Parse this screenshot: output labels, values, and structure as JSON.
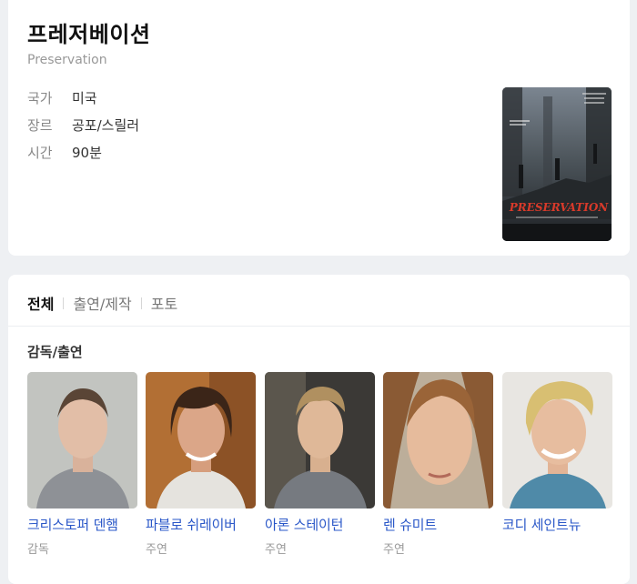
{
  "movie": {
    "title": "프레저베이션",
    "original_title": "Preservation",
    "info": [
      {
        "label": "국가",
        "value": "미국"
      },
      {
        "label": "장르",
        "value": "공포/스릴러"
      },
      {
        "label": "시간",
        "value": "90분"
      }
    ],
    "poster_text": "PRESERVATION"
  },
  "tabs": [
    {
      "label": "전체",
      "active": true
    },
    {
      "label": "출연/제작",
      "active": false
    },
    {
      "label": "포토",
      "active": false
    }
  ],
  "cast_section": {
    "title": "감독/출연",
    "people": [
      {
        "name": "크리스토퍼 덴햄",
        "role": "감독"
      },
      {
        "name": "파블로 쉬레이버",
        "role": "주연"
      },
      {
        "name": "아론 스테이턴",
        "role": "주연"
      },
      {
        "name": "렌 슈미트",
        "role": "주연"
      },
      {
        "name": "코디 세인트뉴",
        "role": ""
      }
    ]
  },
  "colors": {
    "link": "#2a57c8",
    "background": "#eef0f3"
  }
}
